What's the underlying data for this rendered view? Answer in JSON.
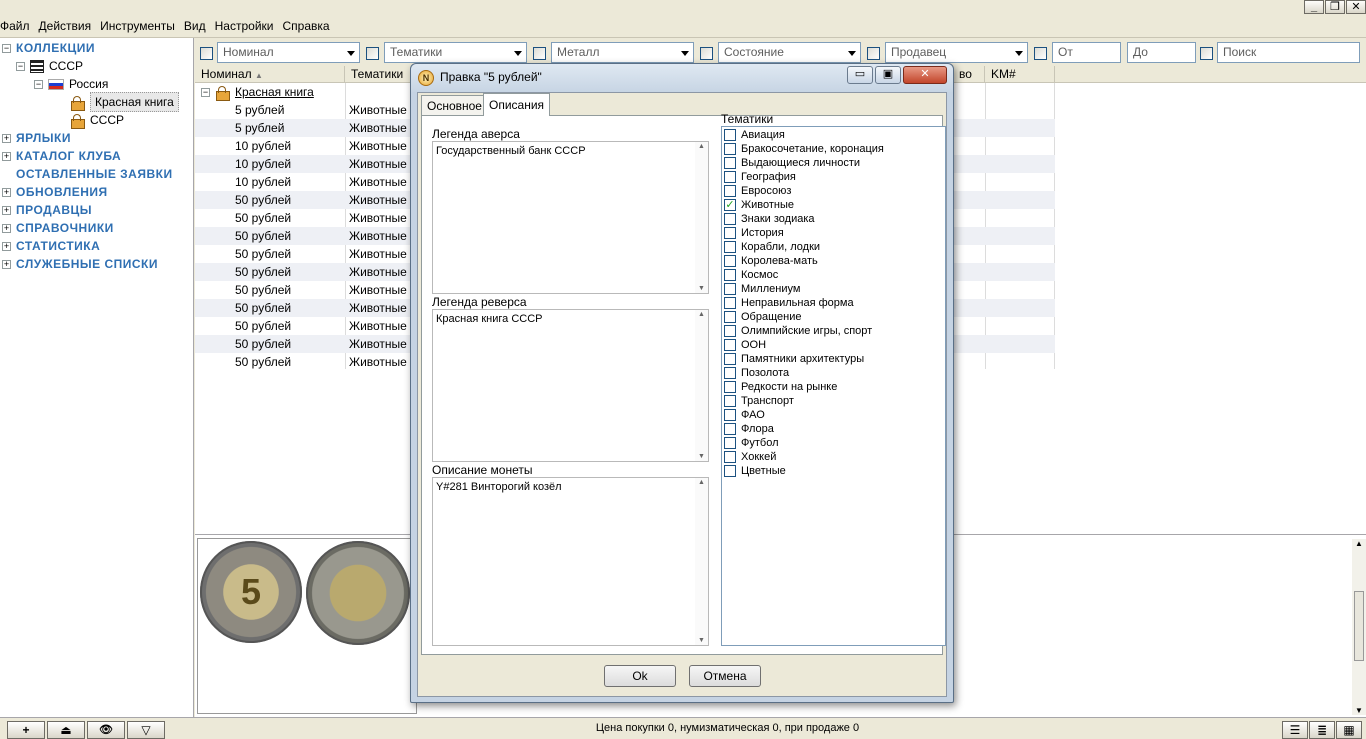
{
  "menubar": {
    "items": [
      "Файл",
      "Действия",
      "Инструменты",
      "Вид",
      "Настройки",
      "Справка"
    ]
  },
  "window_controls": {
    "minimize": "_",
    "restore": "❐",
    "close": "✕"
  },
  "tree": {
    "collections": "КОЛЛЕКЦИИ",
    "ussr": "СССР",
    "russia": "Россия",
    "red_book": "Красная книга",
    "ussr_sub": "СССР",
    "nav": [
      "ЯРЛЫКИ",
      "КАТАЛОГ КЛУБА",
      "ОСТАВЛЕННЫЕ ЗАЯВКИ",
      "ОБНОВЛЕНИЯ",
      "ПРОДАВЦЫ",
      "СПРАВОЧНИКИ",
      "СТАТИСТИКА",
      "СЛУЖЕБНЫЕ СПИСКИ"
    ]
  },
  "filters": {
    "nominal": "Номинал",
    "themes": "Тематики",
    "metal": "Металл",
    "condition": "Состояние",
    "seller": "Продавец",
    "from": "От",
    "to": "До",
    "search": "Поиск"
  },
  "grid": {
    "headers": [
      "Номинал",
      "Тематики",
      "во",
      "KM#"
    ],
    "group": "Красная книга",
    "rows": [
      [
        "5 рублей",
        "Животные"
      ],
      [
        "5 рублей",
        "Животные"
      ],
      [
        "10 рублей",
        "Животные"
      ],
      [
        "10 рублей",
        "Животные"
      ],
      [
        "10 рублей",
        "Животные"
      ],
      [
        "50 рублей",
        "Животные"
      ],
      [
        "50 рублей",
        "Животные"
      ],
      [
        "50 рублей",
        "Животные"
      ],
      [
        "50 рублей",
        "Животные"
      ],
      [
        "50 рублей",
        "Животные"
      ],
      [
        "50 рублей",
        "Животные"
      ],
      [
        "50 рублей",
        "Животные"
      ],
      [
        "50 рублей",
        "Животные"
      ],
      [
        "50 рублей",
        "Животные"
      ],
      [
        "50 рублей",
        "Животные"
      ]
    ]
  },
  "statusbar": {
    "text": "Цена покупки 0, нумизматическая 0, при продаже 0",
    "buttons": [
      "+",
      "⏏",
      "👁",
      "▽"
    ]
  },
  "dialog": {
    "title": "Правка \"5 рублей\"",
    "tabs": [
      "Основное",
      "Описания"
    ],
    "obverse_label": "Легенда аверса",
    "obverse_text": "Государственный банк СССР",
    "reverse_label": "Легенда реверса",
    "reverse_text": "Красная книга СССР",
    "description_label": "Описание монеты",
    "description_text": "Y#281 Винторогий козёл",
    "themes_label": "Тематики",
    "themes": [
      {
        "label": "Авиация",
        "checked": false
      },
      {
        "label": "Бракосочетание, коронация",
        "checked": false
      },
      {
        "label": "Выдающиеся личности",
        "checked": false
      },
      {
        "label": "География",
        "checked": false
      },
      {
        "label": "Евросоюз",
        "checked": false
      },
      {
        "label": "Животные",
        "checked": true
      },
      {
        "label": "Знаки зодиака",
        "checked": false
      },
      {
        "label": "История",
        "checked": false
      },
      {
        "label": "Корабли, лодки",
        "checked": false
      },
      {
        "label": "Королева-мать",
        "checked": false
      },
      {
        "label": "Космос",
        "checked": false
      },
      {
        "label": "Миллениум",
        "checked": false
      },
      {
        "label": "Неправильная форма",
        "checked": false
      },
      {
        "label": "Обращение",
        "checked": false
      },
      {
        "label": "Олимпийские игры, спорт",
        "checked": false
      },
      {
        "label": "ООН",
        "checked": false
      },
      {
        "label": "Памятники архитектуры",
        "checked": false
      },
      {
        "label": "Позолота",
        "checked": false
      },
      {
        "label": "Редкости на рынке",
        "checked": false
      },
      {
        "label": "Транспорт",
        "checked": false
      },
      {
        "label": "ФАО",
        "checked": false
      },
      {
        "label": "Флора",
        "checked": false
      },
      {
        "label": "Футбол",
        "checked": false
      },
      {
        "label": "Хоккей",
        "checked": false
      },
      {
        "label": "Цветные",
        "checked": false
      }
    ],
    "ok": "Ok",
    "cancel": "Отмена"
  },
  "colors": {
    "nav_text": "#2f6fb2",
    "window_bg": "#ece9d8",
    "dialog_frame": "#c5d3e3",
    "close_button": "#c2452b"
  }
}
